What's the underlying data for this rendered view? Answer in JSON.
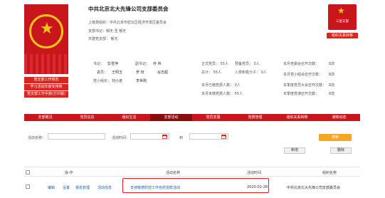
{
  "party": {
    "title": "中共北京北大先锋公司支部委员会",
    "parent_org": "上级党组织：中共北京市密云区经济开发区委员会",
    "secretary": "支部书记：郁无 至 郁无",
    "builder": "共建党支部：   郁无"
  },
  "badge": {
    "text": "三星支部",
    "button": "组织关系转移"
  },
  "members": {
    "secretary_label": "书记：",
    "secretary_val": "彭雪萍",
    "deputy_label": "副书记：",
    "deputy_val": "乔 伟",
    "committee_label": "委员：",
    "committee_vals": [
      "王明玉",
      "罗 玢",
      "谷志超"
    ],
    "group_leader_label": "党小组长：",
    "group_leader_vals": [
      "刘小进",
      "李世刚"
    ]
  },
  "stats_mid": [
    "正式党员：  55人",
    "预备党员：  0人",
    "总计：  55人",
    "入党积极分子：  0人",
    "本月已缴党费人数：  0人",
    "本月未缴党费人数：  55人"
  ],
  "stats_right": [
    {
      "label": "本月党委会召开次数：",
      "value": "0次"
    },
    {
      "label": "本月党小组会召开次数：",
      "value": "0次"
    },
    {
      "label": "本季度党员大会召开次数：",
      "value": "0次"
    },
    {
      "label": "本季度党课召开次数：",
      "value": "0次"
    }
  ],
  "side_buttons": [
    "党支部工作规范",
    "学习活动年度安排表",
    "党支部工作手册(打印版)"
  ],
  "tabs": [
    "支部概况",
    "党员信息",
    "组织生活",
    "支部活动",
    "党员发展",
    "党费管理",
    "组织关系转移",
    "通知动态"
  ],
  "filter": {
    "name_label": "活动名称：",
    "time_label": "活动时间：",
    "to_label": "到",
    "search_button": "搜索",
    "add_button": "新增",
    "delete_button": "删除"
  },
  "table": {
    "headers": [
      "操 作",
      "活动名称",
      "活动时间",
      "组织名称"
    ],
    "row": {
      "ops": [
        "编辑",
        "设置",
        "报名管理",
        "活动信息"
      ],
      "name": "支持敬德防控工作自愿捐款活动",
      "time": "2020-02-28",
      "org": "中共北京北大先锋公司支部委员会"
    }
  },
  "colors": {
    "brand_red": "#c9161d",
    "active_tab": "#8b0c0f",
    "search_orange": "#f5a623",
    "link_blue": "#1a5fb4",
    "highlight": "#e11d1d"
  }
}
